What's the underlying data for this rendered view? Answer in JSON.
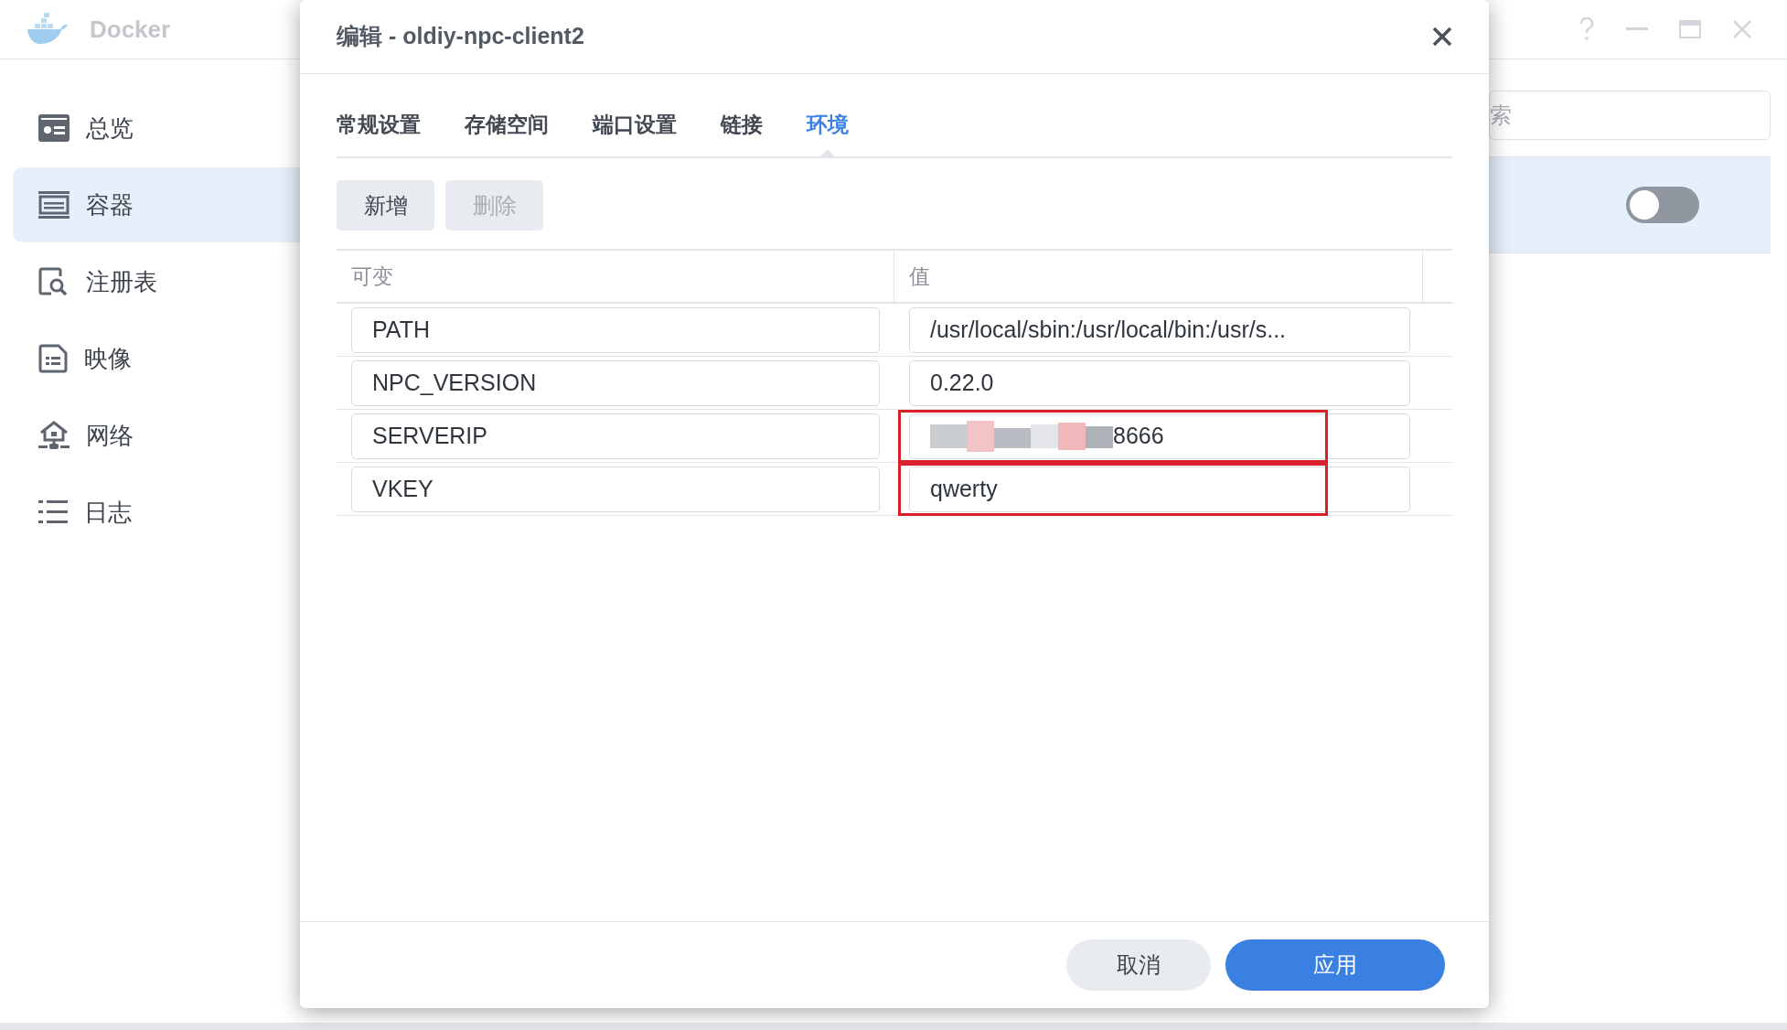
{
  "app": {
    "title": "Docker"
  },
  "sidebar": {
    "items": [
      {
        "label": "总览",
        "kind": "overview",
        "selected": false
      },
      {
        "label": "容器",
        "kind": "container",
        "selected": true
      },
      {
        "label": "注册表",
        "kind": "registry",
        "selected": false
      },
      {
        "label": "映像",
        "kind": "image",
        "selected": false
      },
      {
        "label": "网络",
        "kind": "network",
        "selected": false
      },
      {
        "label": "日志",
        "kind": "log",
        "selected": false
      }
    ]
  },
  "background": {
    "search": {
      "placeholder": "索"
    },
    "toggle": {
      "on": false
    }
  },
  "dialog": {
    "title": "编辑 - oldiy-npc-client2",
    "tabs": [
      {
        "label": "常规设置",
        "selected": false
      },
      {
        "label": "存储空间",
        "selected": false
      },
      {
        "label": "端口设置",
        "selected": false
      },
      {
        "label": "链接",
        "selected": false
      },
      {
        "label": "环境",
        "selected": true
      }
    ],
    "actions": [
      {
        "label": "新增",
        "disabled": false
      },
      {
        "label": "删除",
        "disabled": true
      }
    ],
    "columns": [
      "可变",
      "值"
    ],
    "rows": [
      {
        "name": "PATH",
        "value": "/usr/local/sbin:/usr/local/bin:/usr/s...",
        "redacted": false,
        "highlighted": false
      },
      {
        "name": "NPC_VERSION",
        "value": "0.22.0",
        "redacted": false,
        "highlighted": false
      },
      {
        "name": "SERVERIP",
        "value": "8666",
        "redacted": true,
        "highlighted": true
      },
      {
        "name": "VKEY",
        "value": "qwerty",
        "redacted": false,
        "highlighted": true
      }
    ],
    "footer": [
      {
        "label": "取消",
        "kind": "secondary"
      },
      {
        "label": "应用",
        "kind": "primary"
      }
    ]
  }
}
